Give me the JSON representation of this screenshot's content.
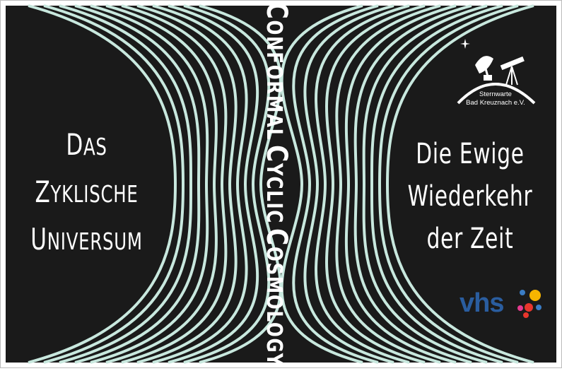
{
  "left_heading": {
    "line1_cap": "D",
    "line1_rest": "AS",
    "line2_cap": "Z",
    "line2_rest": "YKLISCHE",
    "line3_cap": "U",
    "line3_rest": "NIVERSUM"
  },
  "spine_title": {
    "w1_cap": "C",
    "w1_rest": "ONFORMAL",
    "w2_cap": "C",
    "w2_rest": "YCLIC",
    "w3_cap": "C",
    "w3_rest": "OSMOLOGY"
  },
  "right_heading": {
    "line1": "Die Ewige",
    "line2": "Wiederkehr",
    "line3": "der Zeit"
  },
  "observatory_logo": {
    "line1": "Sternwarte",
    "line2": "Bad Kreuznach e.V."
  },
  "vhs_logo": {
    "text": "vhs",
    "dot_colors": [
      "#f6b400",
      "#e8362d",
      "#3a7cc4",
      "#e53a8f"
    ]
  },
  "colors": {
    "background": "#1a1a1a",
    "stripe": "#c8e8de",
    "text": "#ffffff",
    "vhs_blue": "#2a5d9f"
  },
  "icons": [
    "satellite-dish-icon",
    "telescope-icon",
    "star-icon"
  ]
}
